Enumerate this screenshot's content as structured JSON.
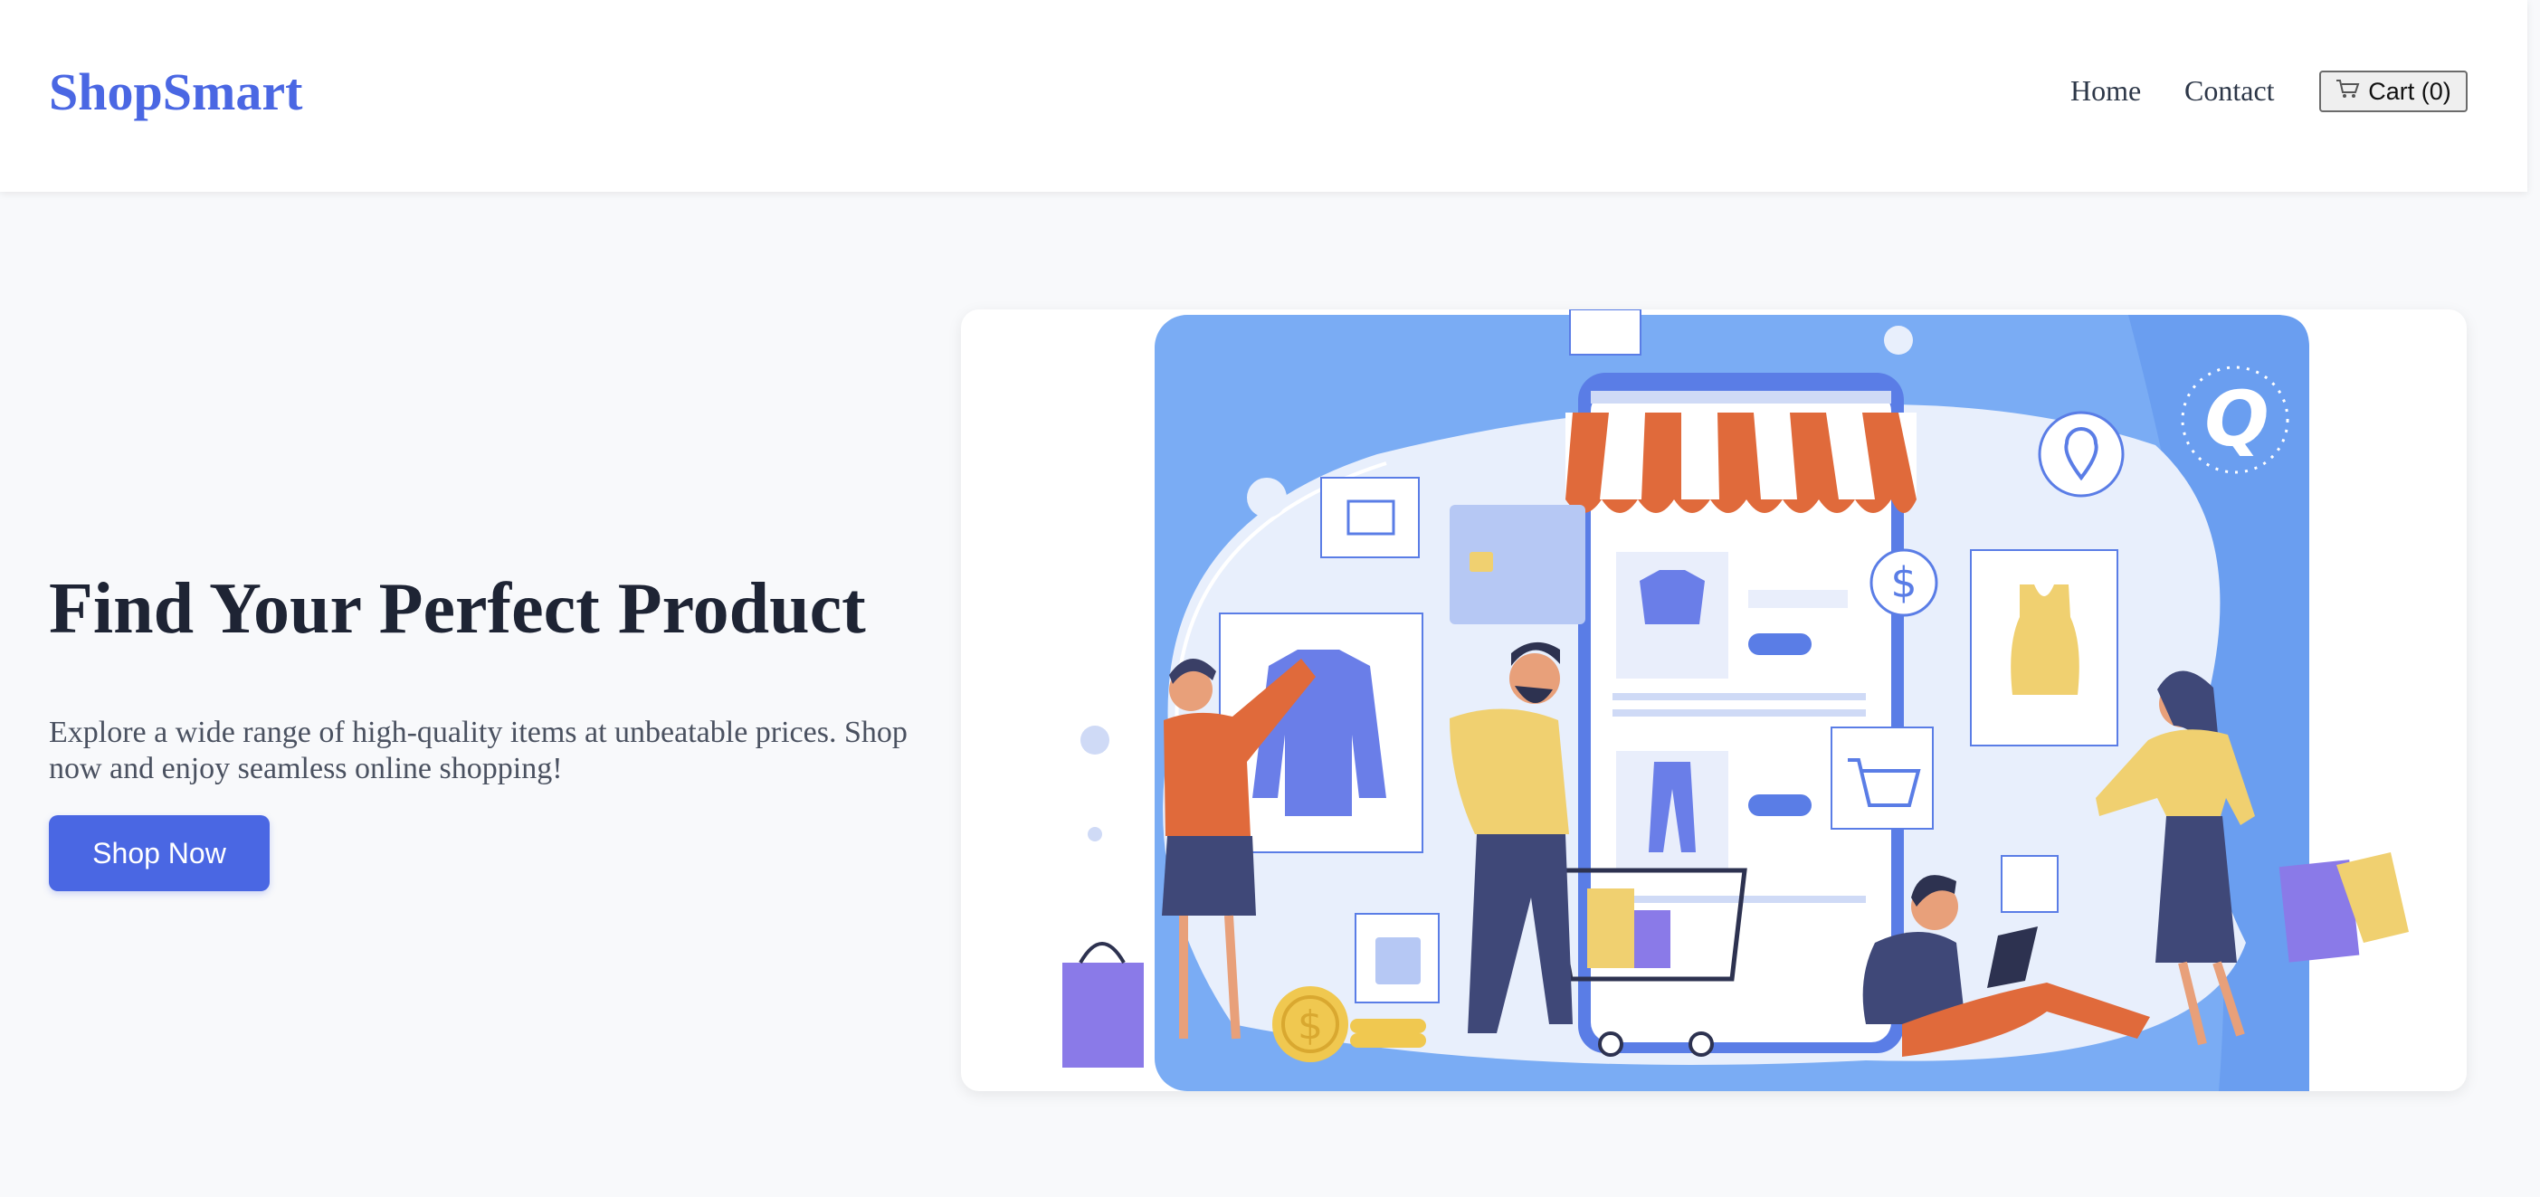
{
  "header": {
    "logo": "ShopSmart",
    "nav": [
      {
        "label": "Home"
      },
      {
        "label": "Contact"
      }
    ],
    "cart_label": "Cart (0)"
  },
  "hero": {
    "title": "Find Your Perfect Product",
    "subtitle": "Explore a wide range of high-quality items at unbeatable prices. Shop now and enjoy seamless online shopping!",
    "cta_label": "Shop Now"
  },
  "colors": {
    "brand": "#4a67e3",
    "illustration_blue": "#7aacf4",
    "awning_orange": "#e06a3b",
    "accent_yellow": "#f0d070",
    "accent_purple": "#8a7ae8"
  },
  "icons": [
    "cart-icon",
    "shop-illustration"
  ]
}
